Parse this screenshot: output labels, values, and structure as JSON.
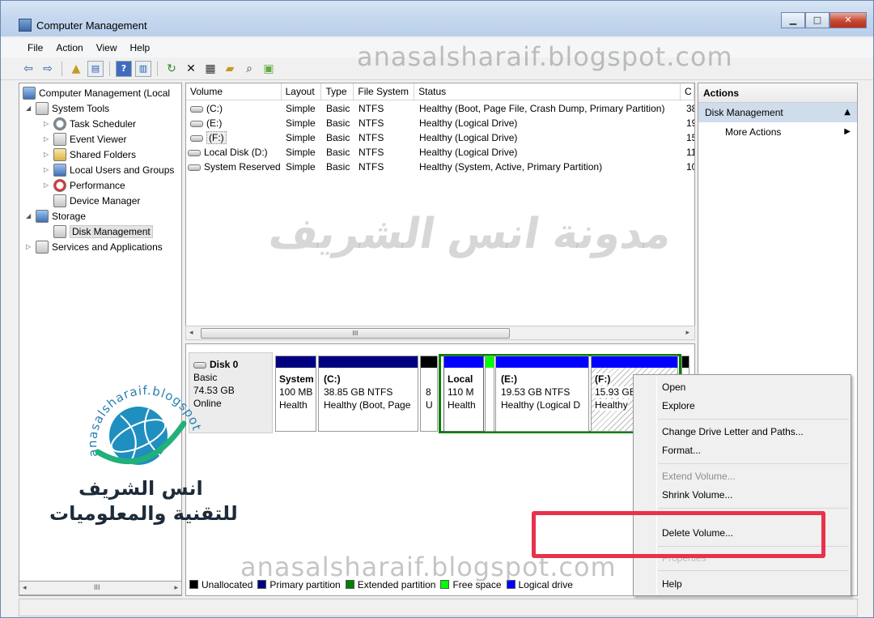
{
  "window": {
    "title": "Computer Management",
    "btn_min": "▁",
    "btn_max": "□",
    "btn_close": "✕"
  },
  "menu": [
    "File",
    "Action",
    "View",
    "Help"
  ],
  "toolbar_icons": [
    "back-arrow-icon",
    "forward-arrow-icon",
    "up-folder-icon",
    "show-hide-tree-icon",
    "help-icon",
    "action-pane-icon",
    "refresh-icon",
    "delete-icon",
    "properties-icon",
    "open-icon",
    "search-icon",
    "export-icon"
  ],
  "watermark": {
    "top": "anasalsharaif.blogspot.com",
    "bottom": "anasalsharaif.blogspot.com",
    "arabic": "مدونة انس الشريف",
    "logo_line1": "انس الشريف",
    "logo_line2": "للتقنية والمعلوميات",
    "logo_arc_text": "anasalsharaif.blogspot.com"
  },
  "tree": {
    "root": "Computer Management (Local",
    "system_tools": "System Tools",
    "task_scheduler": "Task Scheduler",
    "event_viewer": "Event Viewer",
    "shared_folders": "Shared Folders",
    "local_users": "Local Users and Groups",
    "performance": "Performance",
    "device_manager": "Device Manager",
    "storage": "Storage",
    "disk_management": "Disk Management",
    "services": "Services and Applications"
  },
  "volume_table": {
    "headers": [
      "Volume",
      "Layout",
      "Type",
      "File System",
      "Status",
      "C"
    ],
    "rows": [
      [
        "(C:)",
        "Simple",
        "Basic",
        "NTFS",
        "Healthy (Boot, Page File, Crash Dump, Primary Partition)",
        "38"
      ],
      [
        "(E:)",
        "Simple",
        "Basic",
        "NTFS",
        "Healthy (Logical Drive)",
        "19"
      ],
      [
        "(F:)",
        "Simple",
        "Basic",
        "NTFS",
        "Healthy (Logical Drive)",
        "15"
      ],
      [
        "Local Disk (D:)",
        "Simple",
        "Basic",
        "NTFS",
        "Healthy (Logical Drive)",
        "11"
      ],
      [
        "System Reserved",
        "Simple",
        "Basic",
        "NTFS",
        "Healthy (System, Active, Primary Partition)",
        "10"
      ]
    ],
    "scroll_grip": "III"
  },
  "disk": {
    "name": "Disk 0",
    "type": "Basic",
    "size": "74.53 GB",
    "state": "Online",
    "partitions": [
      {
        "title": "System",
        "line2": "100 MB",
        "line3": "Health"
      },
      {
        "title": "(C:)",
        "line2": "38.85 GB NTFS",
        "line3": "Healthy (Boot, Page"
      },
      {
        "title": "",
        "line2": "8",
        "line3": "U"
      },
      {
        "title": "Local",
        "line2": "110 M",
        "line3": "Health"
      },
      {
        "title": "(E:)",
        "line2": "19.53 GB NTFS",
        "line3": "Healthy (Logical D"
      },
      {
        "title": "(F:)",
        "line2": "15.93 GB",
        "line3": "Healthy"
      }
    ]
  },
  "legend": [
    "Unallocated",
    "Primary partition",
    "Extended partition",
    "Free space",
    "Logical drive"
  ],
  "colors": {
    "unallocated": "#000000",
    "primary": "#000080",
    "extended": "#008000",
    "free": "#00ff00",
    "logical": "#0000ff",
    "highlight": "#e8324a"
  },
  "actions": {
    "header": "Actions",
    "section": "Disk Management",
    "more": "More Actions"
  },
  "context_menu": {
    "open": "Open",
    "explore": "Explore",
    "change_letter": "Change Drive Letter and Paths...",
    "format": "Format...",
    "extend": "Extend Volume...",
    "shrink": "Shrink Volume...",
    "delete": "Delete Volume...",
    "properties": "Properties",
    "help": "Help"
  },
  "tree_scroll_grip": "III"
}
